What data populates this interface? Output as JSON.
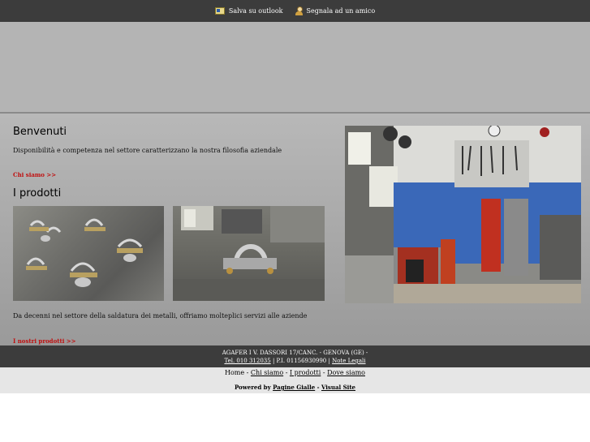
{
  "topbar": {
    "save_outlook": "Salva su outlook",
    "tell_friend": "Segnala ad un amico"
  },
  "welcome": {
    "title": "Benvenuti",
    "text": "Disponibilità e competenza nel settore caratterizzano la nostra filosofia aziendale",
    "link": "Chi siamo >>"
  },
  "products": {
    "title": "I prodotti",
    "text": "Da decenni nel settore della saldatura dei metalli, offriamo molteplici servizi alle aziende",
    "link": "I nostri prodotti >>"
  },
  "footer": {
    "address": "AGAFER I V. DASSORI 17/CANC. - GENOVA (GE) -",
    "tel": "Tel. 010 312035",
    "piva": "P.I. 01156930990",
    "legal": "Note Legali",
    "sep": "|"
  },
  "nav": {
    "home": "Home",
    "chi_siamo": "Chi siamo",
    "prodotti": "I prodotti",
    "dove_siamo": "Dove siamo",
    "dash": "-"
  },
  "powered": {
    "label": "Powered by",
    "pagine_gialle": "Pagine Gialle",
    "dash": "-",
    "visual_site": "Visual Site"
  },
  "colors": {
    "topbar": "#3c3c3c",
    "banner": "#b4b4b4",
    "link_red": "#c01010"
  }
}
